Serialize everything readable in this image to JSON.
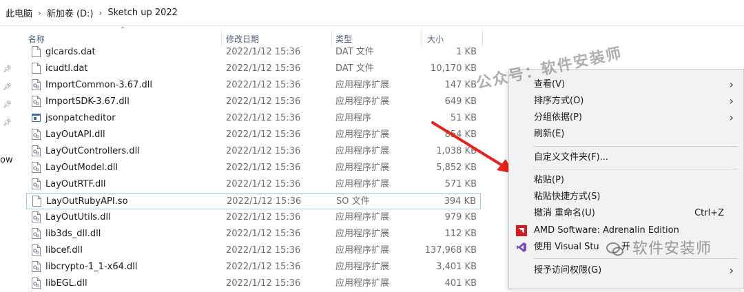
{
  "breadcrumb": [
    "此电脑",
    "新加卷 (D:)",
    "Sketch up 2022"
  ],
  "nav_cut_text": "ow",
  "columns": {
    "name": "名称",
    "date": "修改日期",
    "type": "类型",
    "size": "大小"
  },
  "files": [
    {
      "name": "glcards.dat",
      "date": "2022/1/12 15:36",
      "type": "DAT 文件",
      "size": "1 KB",
      "icon": "file-icon"
    },
    {
      "name": "icudtl.dat",
      "date": "2022/1/12 15:36",
      "type": "DAT 文件",
      "size": "10,170 KB",
      "icon": "file-icon"
    },
    {
      "name": "ImportCommon-3.67.dll",
      "date": "2022/1/12 15:36",
      "type": "应用程序扩展",
      "size": "147 KB",
      "icon": "dll-icon"
    },
    {
      "name": "ImportSDK-3.67.dll",
      "date": "2022/1/12 15:36",
      "type": "应用程序扩展",
      "size": "649 KB",
      "icon": "dll-icon"
    },
    {
      "name": "jsonpatcheditor",
      "date": "2022/1/12 15:36",
      "type": "应用程序",
      "size": "51 KB",
      "icon": "exe-icon"
    },
    {
      "name": "LayOutAPI.dll",
      "date": "2022/1/12 15:36",
      "type": "应用程序扩展",
      "size": "854 KB",
      "icon": "dll-icon"
    },
    {
      "name": "LayOutControllers.dll",
      "date": "2022/1/12 15:36",
      "type": "应用程序扩展",
      "size": "1,038 KB",
      "icon": "dll-icon"
    },
    {
      "name": "LayOutModel.dll",
      "date": "2022/1/12 15:36",
      "type": "应用程序扩展",
      "size": "5,852 KB",
      "icon": "dll-icon"
    },
    {
      "name": "LayOutRTF.dll",
      "date": "2022/1/12 15:36",
      "type": "应用程序扩展",
      "size": "571 KB",
      "icon": "dll-icon"
    },
    {
      "name": "LayOutRubyAPI.so",
      "date": "2022/1/12 15:36",
      "type": "SO 文件",
      "size": "394 KB",
      "icon": "file-icon",
      "selected": true
    },
    {
      "name": "LayOutUtils.dll",
      "date": "2022/1/12 15:36",
      "type": "应用程序扩展",
      "size": "979 KB",
      "icon": "dll-icon"
    },
    {
      "name": "lib3ds_dll.dll",
      "date": "2022/1/12 15:36",
      "type": "应用程序扩展",
      "size": "112 KB",
      "icon": "dll-icon"
    },
    {
      "name": "libcef.dll",
      "date": "2022/1/12 15:36",
      "type": "应用程序扩展",
      "size": "137,968 KB",
      "icon": "dll-icon"
    },
    {
      "name": "libcrypto-1_1-x64.dll",
      "date": "2022/1/12 15:36",
      "type": "应用程序扩展",
      "size": "3,401 KB",
      "icon": "dll-icon"
    },
    {
      "name": "libEGL.dll",
      "date": "2022/1/12 15:36",
      "type": "应用程序扩展",
      "size": "401 KB",
      "icon": "dll-icon"
    }
  ],
  "context_menu": {
    "view": "查看(V)",
    "sort": "排序方式(O)",
    "group": "分组依据(P)",
    "refresh": "刷新(E)",
    "customize": "自定义文件夹(F)...",
    "paste": "粘贴(P)",
    "paste_shortcut": "粘贴快捷方式(S)",
    "undo": "撤消 重命名(U)",
    "undo_shortcut": "Ctrl+Z",
    "amd": "AMD Software: Adrenalin Edition",
    "vs": "使用 Visual Stu",
    "vs_tail": "开",
    "grant": "授予访问权限(G)"
  },
  "watermarks": {
    "top": "公众号：软件安装师",
    "bottom": "软件安装师"
  },
  "colors": {
    "arrow": "#e8211c",
    "amd": "#d71920",
    "vs": "#7b4cc0",
    "selection_border": "#99c9ef"
  }
}
